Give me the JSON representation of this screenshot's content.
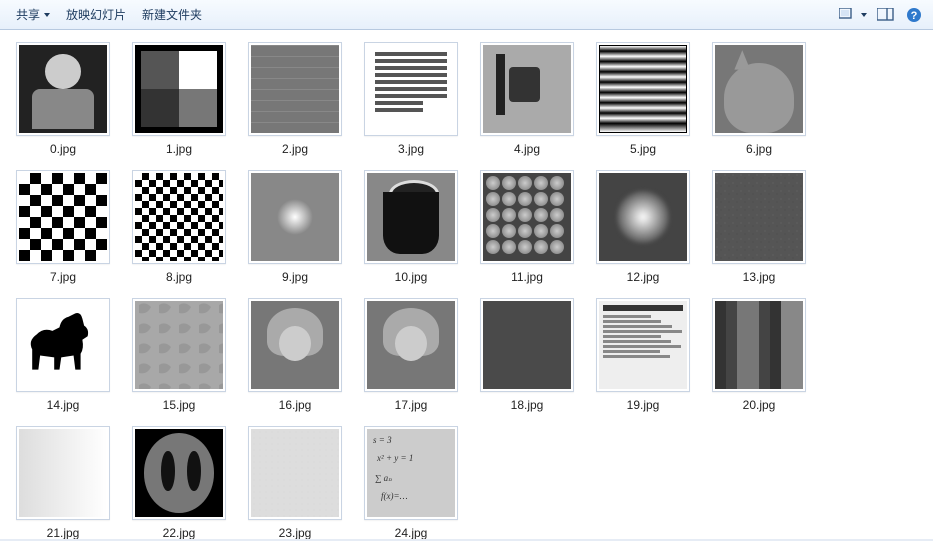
{
  "toolbar": {
    "share": "共享",
    "slideshow": "放映幻灯片",
    "new_folder": "新建文件夹"
  },
  "files": [
    {
      "name": "0.jpg",
      "kind": "astronaut"
    },
    {
      "name": "1.jpg",
      "kind": "quadrant"
    },
    {
      "name": "2.jpg",
      "kind": "tiles"
    },
    {
      "name": "3.jpg",
      "kind": "text"
    },
    {
      "name": "4.jpg",
      "kind": "camera"
    },
    {
      "name": "5.jpg",
      "kind": "stripes"
    },
    {
      "name": "6.jpg",
      "kind": "cat"
    },
    {
      "name": "7.jpg",
      "kind": "checker"
    },
    {
      "name": "8.jpg",
      "kind": "checker-fine"
    },
    {
      "name": "9.jpg",
      "kind": "blob"
    },
    {
      "name": "10.jpg",
      "kind": "cup"
    },
    {
      "name": "11.jpg",
      "kind": "coins"
    },
    {
      "name": "12.jpg",
      "kind": "soft"
    },
    {
      "name": "13.jpg",
      "kind": "dark-noise"
    },
    {
      "name": "14.jpg",
      "kind": "horse"
    },
    {
      "name": "15.jpg",
      "kind": "texture"
    },
    {
      "name": "16.jpg",
      "kind": "lena"
    },
    {
      "name": "17.jpg",
      "kind": "lena"
    },
    {
      "name": "18.jpg",
      "kind": "dark"
    },
    {
      "name": "19.jpg",
      "kind": "textbox"
    },
    {
      "name": "20.jpg",
      "kind": "pixelate"
    },
    {
      "name": "21.jpg",
      "kind": "gradient"
    },
    {
      "name": "22.jpg",
      "kind": "phantom"
    },
    {
      "name": "23.jpg",
      "kind": "light"
    },
    {
      "name": "24.jpg",
      "kind": "math"
    }
  ]
}
